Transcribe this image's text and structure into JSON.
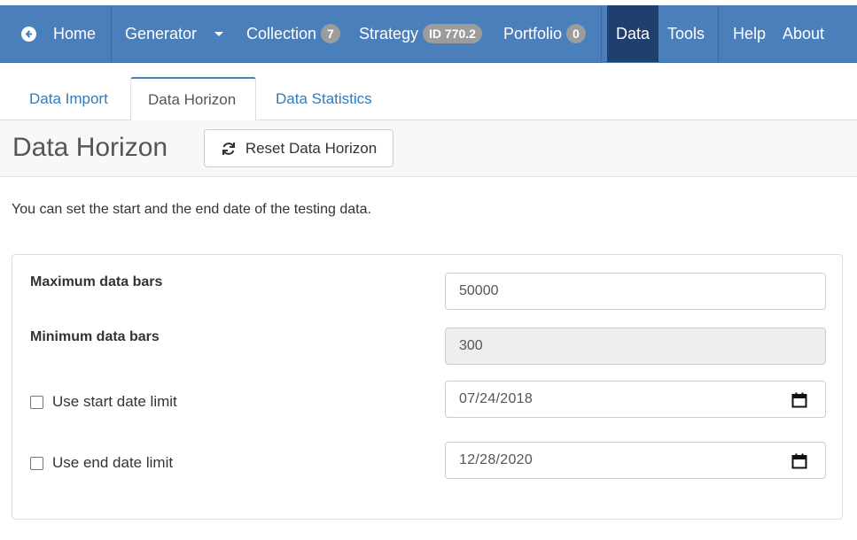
{
  "nav": {
    "home": "Home",
    "generator": "Generator",
    "collection": "Collection",
    "collection_badge": "7",
    "strategy": "Strategy",
    "strategy_badge": "ID 770.2",
    "portfolio": "Portfolio",
    "portfolio_badge": "0",
    "data": "Data",
    "tools": "Tools",
    "help": "Help",
    "about": "About"
  },
  "tabs": [
    {
      "label": "Data Import"
    },
    {
      "label": "Data Horizon"
    },
    {
      "label": "Data Statistics"
    }
  ],
  "page": {
    "title": "Data Horizon",
    "reset_label": "Reset Data Horizon",
    "description": "You can set the start and the end date of the testing data."
  },
  "form": {
    "max_bars_label": "Maximum data bars",
    "max_bars_value": "50000",
    "min_bars_label": "Minimum data bars",
    "min_bars_value": "300",
    "start_label": "Use start date limit",
    "start_value": "07/24/2018",
    "end_label": "Use end date limit",
    "end_value": "12/28/2020"
  },
  "colors": {
    "navbar": "#4a7fbb",
    "active_nav": "#1f3f6e",
    "link": "#337ab7"
  }
}
